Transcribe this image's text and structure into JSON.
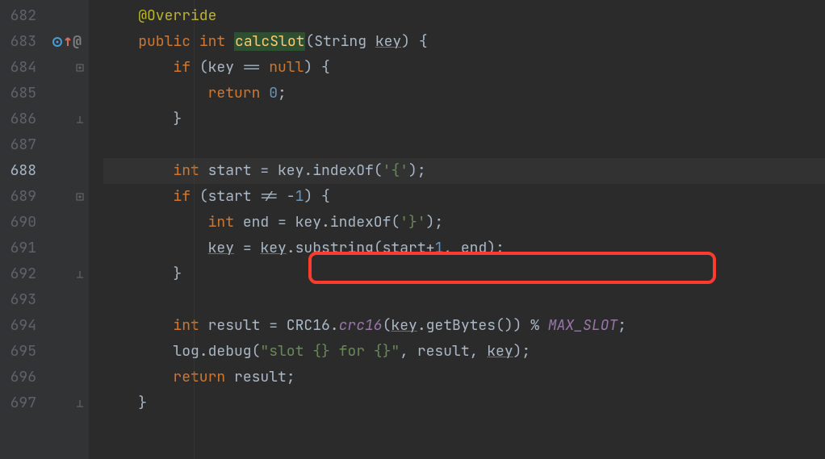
{
  "gutter": {
    "lines": [
      {
        "n": "682",
        "current": false
      },
      {
        "n": "683",
        "current": false,
        "icons": true
      },
      {
        "n": "684",
        "current": false
      },
      {
        "n": "685",
        "current": false
      },
      {
        "n": "686",
        "current": false
      },
      {
        "n": "687",
        "current": false
      },
      {
        "n": "688",
        "current": true
      },
      {
        "n": "689",
        "current": false
      },
      {
        "n": "690",
        "current": false
      },
      {
        "n": "691",
        "current": false
      },
      {
        "n": "692",
        "current": false
      },
      {
        "n": "693",
        "current": false
      },
      {
        "n": "694",
        "current": false
      },
      {
        "n": "695",
        "current": false
      },
      {
        "n": "696",
        "current": false
      },
      {
        "n": "697",
        "current": false
      }
    ]
  },
  "row683": {
    "at": "@"
  },
  "code": {
    "l682": {
      "ann": "@Override"
    },
    "l683": {
      "kw1": "public ",
      "kw2": "int ",
      "fn": "calcSlot",
      "a": "(String ",
      "p": "key",
      "b": ") {"
    },
    "l684": {
      "kw": "if ",
      "a": "(key == ",
      "kw2": "null",
      "b": ") {"
    },
    "l685": {
      "kw": "return ",
      "num": "0",
      "b": ";"
    },
    "l686": {
      "a": "}"
    },
    "l688": {
      "kw": "int ",
      "a": "start = key.indexOf(",
      "s": "'{'",
      "b": ");"
    },
    "l689": {
      "kw": "if ",
      "a": "(start != -",
      "num": "1",
      "b": ") {"
    },
    "l690": {
      "kw": "int ",
      "a": "end = key.indexOf(",
      "s": "'}'",
      "b": ");"
    },
    "l691": {
      "p": "key",
      "a": " = ",
      "p2": "key",
      "b": ".substring(start+",
      "num": "1",
      "c": ", end);"
    },
    "l692": {
      "a": "}"
    },
    "l694": {
      "kw": "int ",
      "a": "result = CRC16.",
      "fn": "crc16",
      "b": "(",
      "p": "key",
      "c": ".getBytes()) % ",
      "cons": "MAX_SLOT",
      "d": ";"
    },
    "l695": {
      "a": "log.debug(",
      "s": "\"slot {} for {}\"",
      "b": ", result, ",
      "p": "key",
      "c": ");"
    },
    "l696": {
      "kw": "return ",
      "a": "result;"
    },
    "l697": {
      "a": "}"
    }
  }
}
